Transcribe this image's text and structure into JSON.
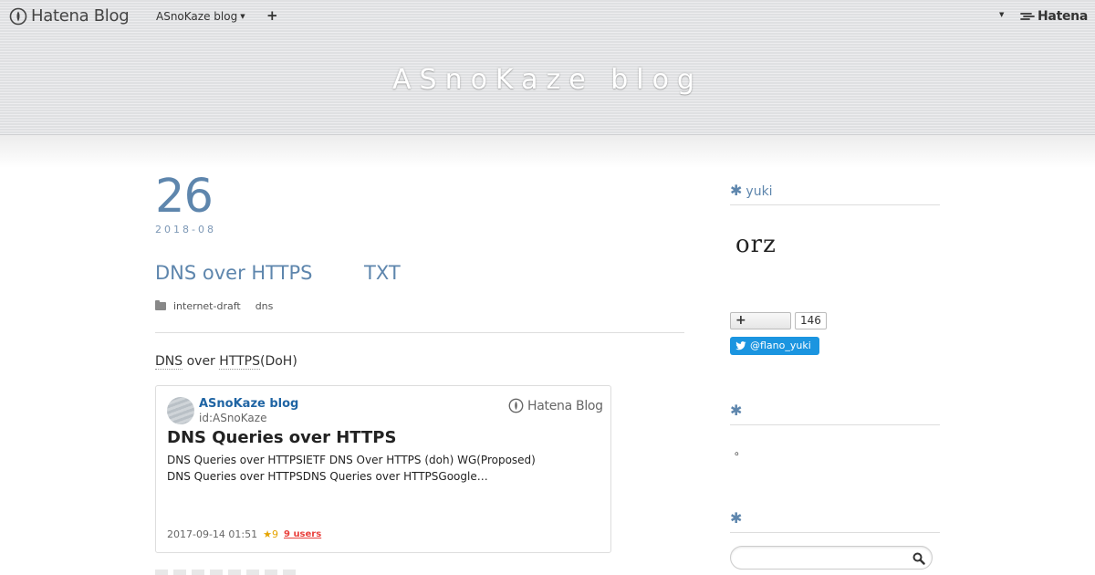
{
  "globalbar": {
    "logo_text": "Hatena Blog",
    "blog_menu_label": "ASnoKaze blog",
    "add_label": "+",
    "hatena_label": "Hatena"
  },
  "header": {
    "blog_title": "ASnoKaze blog"
  },
  "entry": {
    "day": "26",
    "year_month": "2018-08",
    "title_part1": "DNS over HTTPS",
    "title_part2": "TXT",
    "categories": [
      "internet-draft",
      "dns"
    ],
    "lead_part1": "DNS",
    "lead_part2": " over ",
    "lead_part3": "HTTPS",
    "lead_part4": "(DoH)"
  },
  "embed_card": {
    "blog_name": "ASnoKaze blog",
    "blog_id": "id:ASnoKaze",
    "brand": "Hatena Blog",
    "title": "DNS Queries over HTTPS",
    "desc_line1": "DNS Queries over HTTPSIETF DNS Over HTTPS (doh) WG(Proposed)",
    "desc_line2": "DNS Queries over HTTPSDNS Queries over HTTPSGoogle…",
    "date": "2017-09-14 01:51",
    "stars": "★9",
    "users": "9 users"
  },
  "sidebar": {
    "profile_title": "yuki",
    "profile_image_text": "orz",
    "follow_label": "+",
    "follow_count": "146",
    "twitter_label": "@flano_yuki",
    "about_title": "",
    "about_text": "。",
    "search_title": "",
    "search_placeholder": ""
  },
  "colors": {
    "accent": "#5e86ad",
    "link": "#2065a4",
    "twitter": "#1b95e0",
    "star": "#e5a400",
    "users": "#e9413d"
  }
}
